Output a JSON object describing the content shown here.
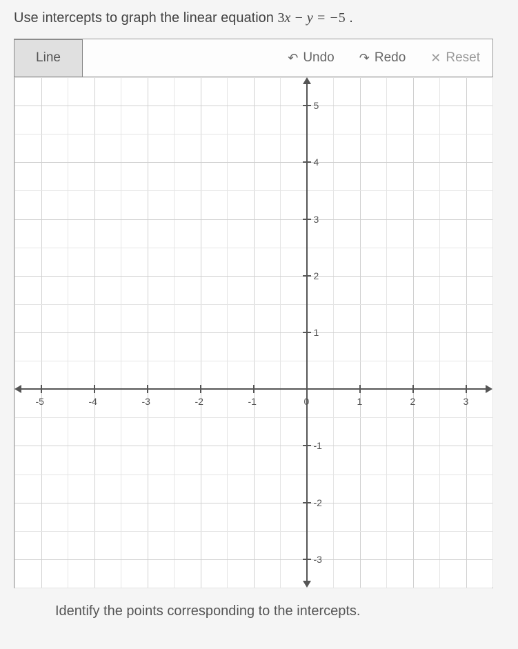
{
  "question": {
    "prefix": "Use intercepts to graph the linear equation ",
    "equation_display": "3x − y = −5",
    "suffix": " ."
  },
  "toolbar": {
    "line_label": "Line",
    "undo_label": "Undo",
    "redo_label": "Redo",
    "reset_label": "Reset",
    "undo_icon": "↶",
    "redo_icon": "↷",
    "reset_icon": "✕"
  },
  "chart_data": {
    "type": "scatter",
    "title": "",
    "xlabel": "",
    "ylabel": "",
    "xlim": [
      -5.5,
      3.5
    ],
    "ylim": [
      -3.5,
      5.5
    ],
    "x_ticks": [
      -5,
      -4,
      -3,
      -2,
      -1,
      0,
      1,
      2,
      3
    ],
    "y_ticks": [
      -3,
      -2,
      -1,
      0,
      1,
      2,
      3,
      4,
      5
    ],
    "grid": true,
    "minor_grid": true,
    "series": []
  },
  "instruction": "Identify the points corresponding to the intercepts."
}
